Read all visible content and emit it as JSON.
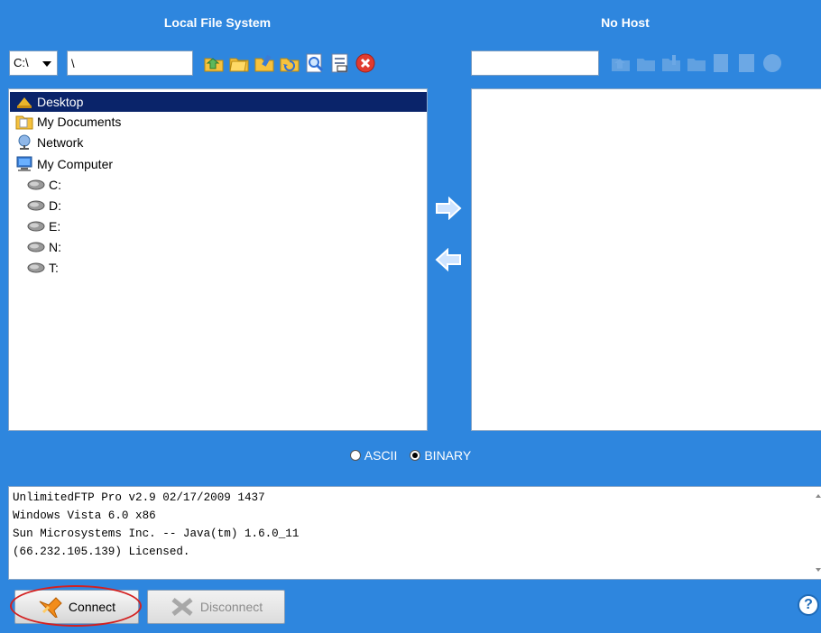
{
  "local": {
    "title": "Local File System",
    "drive": "C:\\",
    "path": "\\",
    "toolbar": [
      {
        "icon": "upload-folder-icon"
      },
      {
        "icon": "new-folder-icon"
      },
      {
        "icon": "rename-folder-icon"
      },
      {
        "icon": "refresh-folder-icon"
      },
      {
        "icon": "view-file-icon"
      },
      {
        "icon": "properties-icon"
      },
      {
        "icon": "delete-icon"
      }
    ],
    "tree": [
      {
        "label": "Desktop",
        "icon": "desktop-icon",
        "selected": true
      },
      {
        "label": "My Documents",
        "icon": "documents-icon"
      },
      {
        "label": "Network",
        "icon": "network-icon"
      },
      {
        "label": "My Computer",
        "icon": "computer-icon"
      },
      {
        "label": "C:",
        "icon": "drive-icon"
      },
      {
        "label": "D:",
        "icon": "drive-icon"
      },
      {
        "label": "E:",
        "icon": "drive-icon"
      },
      {
        "label": "N:",
        "icon": "drive-icon"
      },
      {
        "label": "T:",
        "icon": "drive-icon"
      }
    ]
  },
  "remote": {
    "title": "No Host",
    "path": ""
  },
  "transfer": {
    "upload_icon": "arrow-right-icon",
    "download_icon": "arrow-left-icon"
  },
  "mode": {
    "ascii_label": "ASCII",
    "binary_label": "BINARY",
    "selected": "BINARY"
  },
  "console": {
    "lines": [
      "UnlimitedFTP Pro v2.9 02/17/2009 1437",
      "Windows Vista 6.0 x86",
      "Sun Microsystems Inc. -- Java(tm) 1.6.0_11",
      "(66.232.105.139) Licensed."
    ]
  },
  "buttons": {
    "connect": "Connect",
    "disconnect": "Disconnect",
    "help": "?"
  },
  "colors": {
    "background": "#2e86de",
    "selection": "#0a246a",
    "highlight": "#d32020"
  }
}
